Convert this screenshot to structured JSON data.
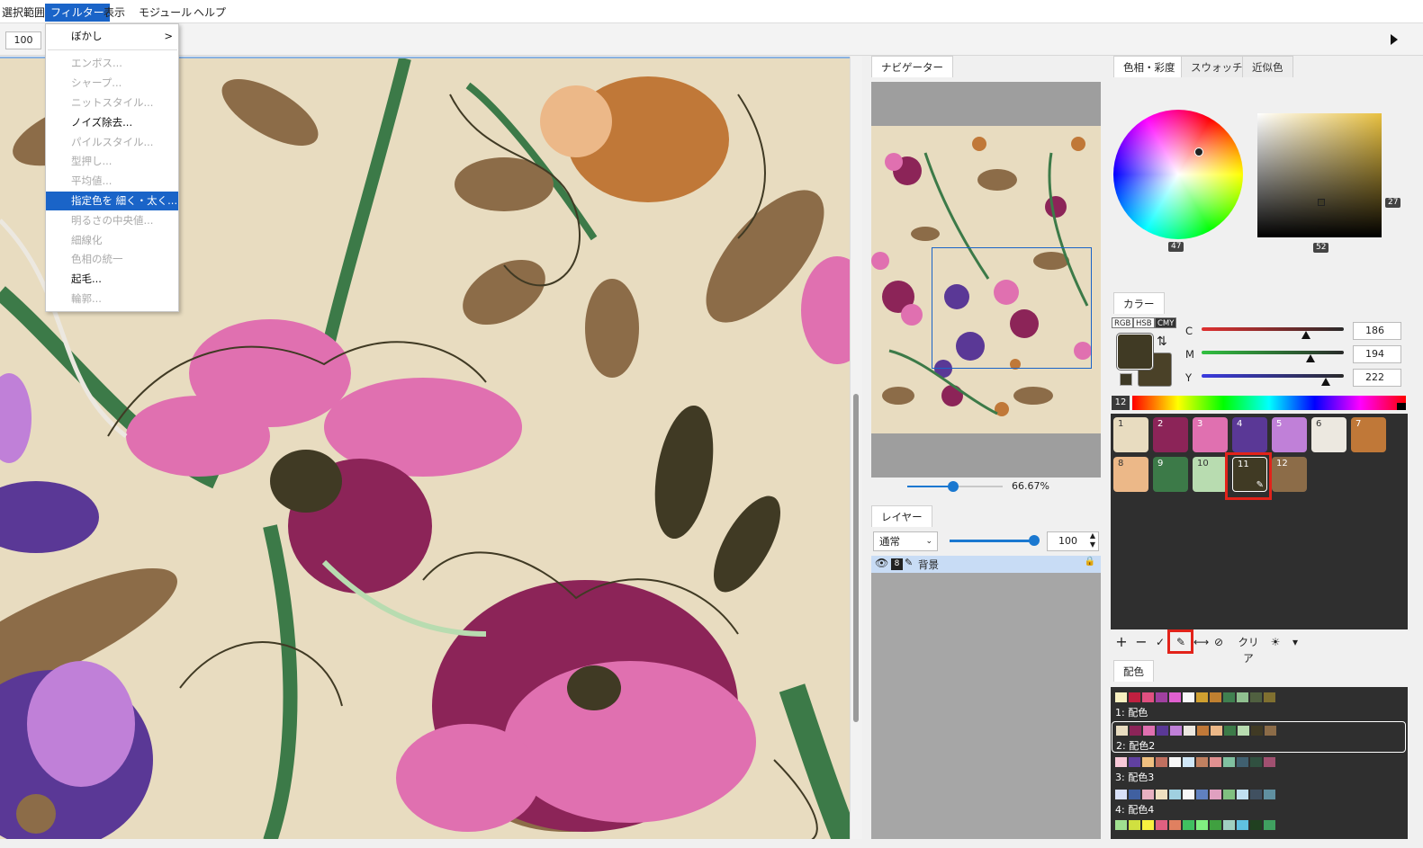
{
  "menubar": {
    "items": [
      {
        "label": "選択範囲"
      },
      {
        "label": "フィルター",
        "active": true
      },
      {
        "label": "表示"
      },
      {
        "label": "モジュール"
      },
      {
        "label": "ヘルプ"
      }
    ]
  },
  "toolbar": {
    "zoom_value": "100"
  },
  "filter_menu": {
    "items": [
      {
        "label": "ぼかし",
        "enabled": true,
        "submenu": true
      },
      {
        "label": "エンボス...",
        "enabled": false
      },
      {
        "label": "シャープ...",
        "enabled": false
      },
      {
        "label": "ニットスタイル...",
        "enabled": false
      },
      {
        "label": "ノイズ除去...",
        "enabled": true
      },
      {
        "label": "パイルスタイル...",
        "enabled": false
      },
      {
        "label": "型押し...",
        "enabled": false
      },
      {
        "label": "平均値...",
        "enabled": false
      },
      {
        "label": "指定色を 細く・太く...",
        "enabled": true,
        "selected": true
      },
      {
        "label": "明るさの中央値...",
        "enabled": false
      },
      {
        "label": "細線化",
        "enabled": false
      },
      {
        "label": "色相の統一",
        "enabled": false
      },
      {
        "label": "起毛...",
        "enabled": true
      },
      {
        "label": "輪郭...",
        "enabled": false
      }
    ],
    "submenu_arrow": ">"
  },
  "navigator": {
    "tab": "ナビゲーター",
    "zoom": "66.67%"
  },
  "layers": {
    "tab": "レイヤー",
    "blend_mode": "通常",
    "opacity": "100",
    "rows": [
      {
        "name": "背景",
        "number": "8"
      }
    ]
  },
  "color_tabs": {
    "items": [
      "色相・彩度",
      "スウォッチ",
      "近似色"
    ]
  },
  "hue_badge": "47",
  "sv_badge_right": "27",
  "sv_badge_bottom": "52",
  "color_panel": {
    "tab": "カラー",
    "modes": [
      "RGB",
      "HSB",
      "CMY"
    ],
    "active_mode": "CMY",
    "channels": [
      {
        "label": "C",
        "value": "186",
        "track_color": "linear-gradient(to right,#e03030,#2a2a2a)"
      },
      {
        "label": "M",
        "value": "194",
        "track_color": "linear-gradient(to right,#30c040,#2a2a2a)"
      },
      {
        "label": "Y",
        "value": "222",
        "track_color": "linear-gradient(to right,#3a3ae0,#2a2a2a)"
      }
    ],
    "foreground": "#403a24"
  },
  "swatches": {
    "count": "12",
    "items": [
      {
        "num": "1",
        "color": "#e8dcc0",
        "light": true
      },
      {
        "num": "2",
        "color": "#8c2458"
      },
      {
        "num": "3",
        "color": "#e070b0"
      },
      {
        "num": "4",
        "color": "#5a3896"
      },
      {
        "num": "5",
        "color": "#c080d8"
      },
      {
        "num": "6",
        "color": "#ece8e0",
        "light": true
      },
      {
        "num": "7",
        "color": "#c07838"
      },
      {
        "num": "8",
        "color": "#ecb888",
        "light": true
      },
      {
        "num": "9",
        "color": "#3c7a48"
      },
      {
        "num": "10",
        "color": "#b8dcb0",
        "light": true
      },
      {
        "num": "11",
        "color": "#403a24",
        "selected": true
      },
      {
        "num": "12",
        "color": "#8c6c48"
      }
    ],
    "toolbar": {
      "add": "+",
      "remove": "−",
      "check": "✓",
      "edit": "✎",
      "swap": "⟷",
      "none": "⊘",
      "clear": "クリア",
      "light": "☀",
      "more": "▾"
    }
  },
  "schemes": {
    "tab": "配色",
    "items": [
      {
        "name": "1: 配色",
        "chips": [
          "#f8f0c0",
          "#c02040",
          "#e05080",
          "#a040a0",
          "#e060d0",
          "#f8f8f8",
          "#d0a030",
          "#c08030",
          "#408050",
          "#90c090",
          "#506040",
          "#807030"
        ]
      },
      {
        "name": "2: 配色2",
        "selected": true,
        "chips": [
          "#e8dcc0",
          "#8c2458",
          "#e070b0",
          "#5a3896",
          "#c080d8",
          "#ece8e0",
          "#c07838",
          "#ecb888",
          "#3c7a48",
          "#b8dcb0",
          "#403a24",
          "#8c6c48"
        ]
      },
      {
        "name": "3: 配色3",
        "chips": [
          "#f8c8d8",
          "#6040a0",
          "#f0c080",
          "#c07060",
          "#f8f8f8",
          "#d0e8f8",
          "#c08060",
          "#e09090",
          "#80c0a0",
          "#406070",
          "#305040",
          "#a05070"
        ]
      },
      {
        "name": "4: 配色4",
        "chips": [
          "#d8e0f8",
          "#4060a0",
          "#e8b0c0",
          "#f0e0c0",
          "#a0d0e0",
          "#f8f8f8",
          "#6080c0",
          "#e0a0c0",
          "#80c080",
          "#c0e0f0",
          "#405060",
          "#6090a0"
        ]
      },
      {
        "name": "",
        "chips": [
          "#a0e090",
          "#d0e040",
          "#f8f040",
          "#e06080",
          "#e08060",
          "#40c060",
          "#80f080",
          "#40a040",
          "#a0d0c0",
          "#60c0e0",
          "#204020",
          "#40a060"
        ]
      }
    ]
  }
}
